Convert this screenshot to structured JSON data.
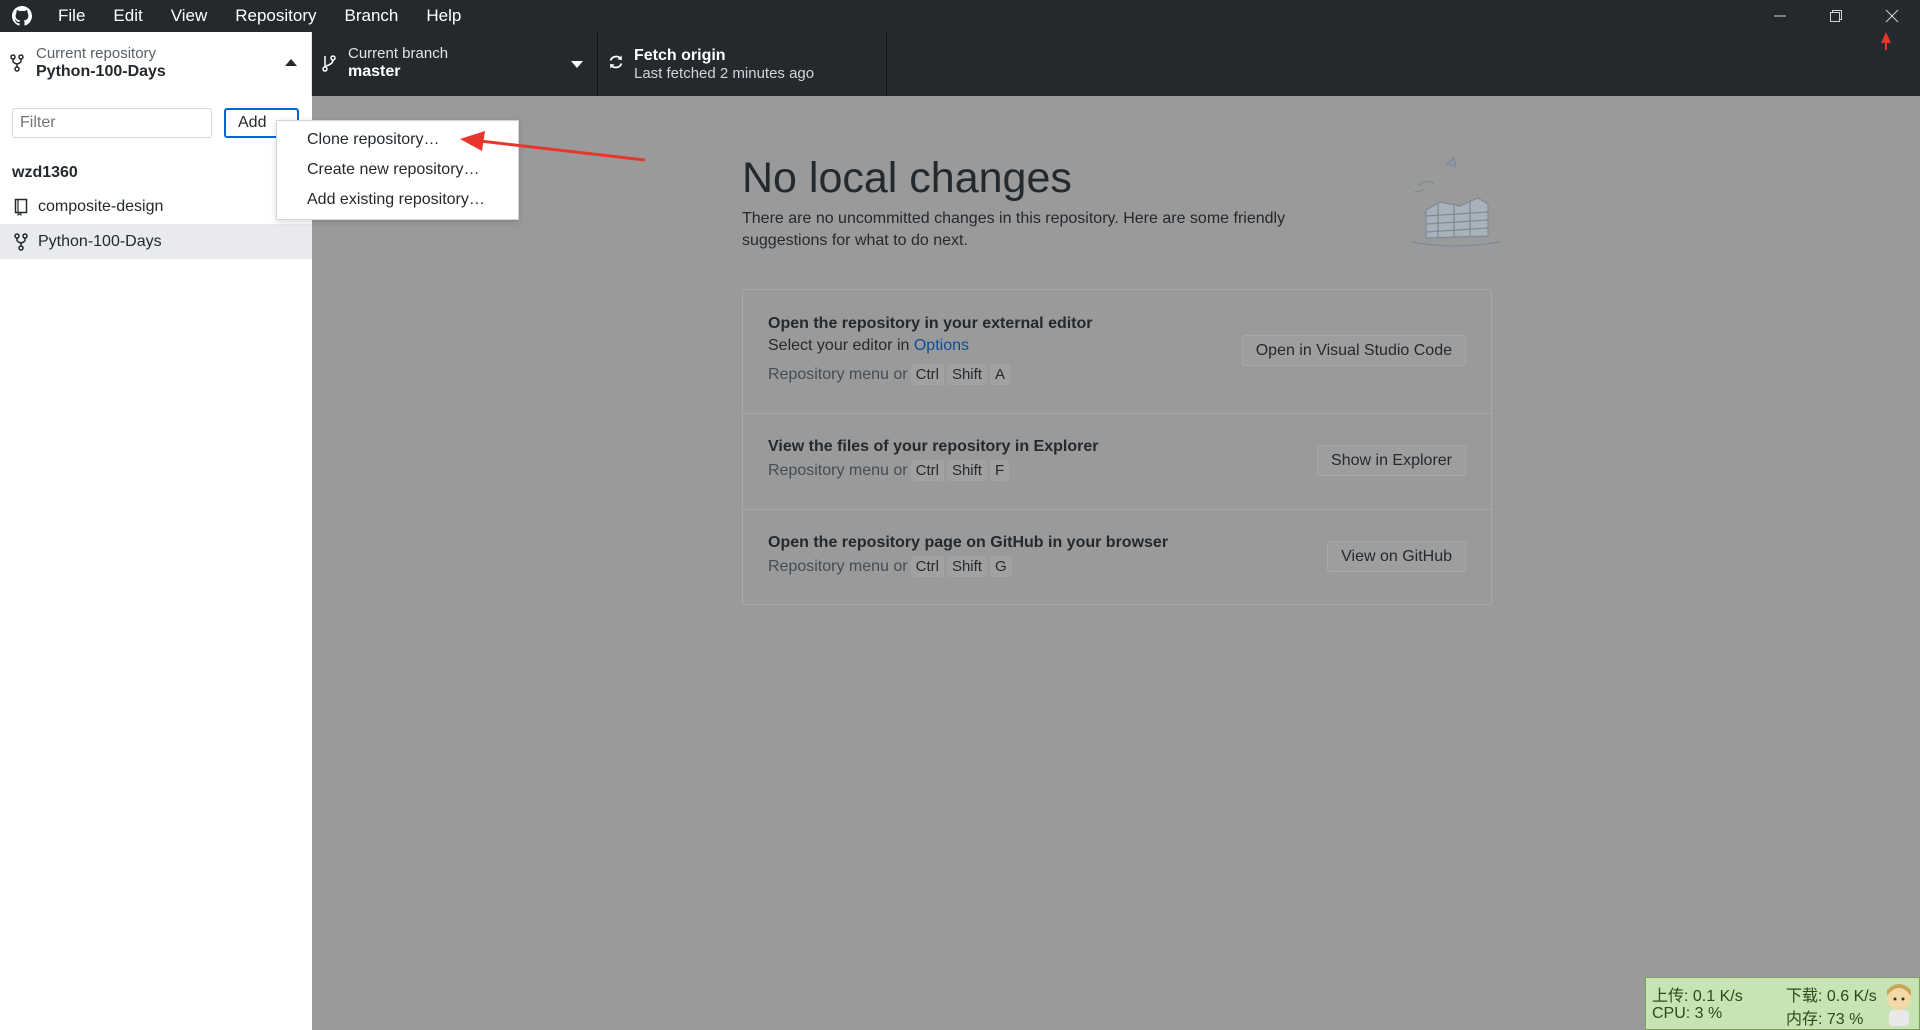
{
  "menubar": {
    "items": [
      "File",
      "Edit",
      "View",
      "Repository",
      "Branch",
      "Help"
    ]
  },
  "toolbar": {
    "repo_label": "Current repository",
    "repo_value": "Python-100-Days",
    "branch_label": "Current branch",
    "branch_value": "master",
    "fetch_label": "Fetch origin",
    "fetch_value": "Last fetched 2 minutes ago"
  },
  "sidebar": {
    "filter_placeholder": "Filter",
    "add_label": "Add",
    "group_title": "wzd1360",
    "repos": [
      {
        "name": "composite-design",
        "icon": "repo-icon",
        "selected": false
      },
      {
        "name": "Python-100-Days",
        "icon": "fork-icon",
        "selected": true
      }
    ]
  },
  "dropdown": {
    "items": [
      "Clone repository…",
      "Create new repository…",
      "Add existing repository…"
    ]
  },
  "main": {
    "heading": "No local changes",
    "description": "There are no uncommitted changes in this repository. Here are some friendly suggestions for what to do next.",
    "suggestions": [
      {
        "title": "Open the repository in your external editor",
        "sub_prefix": "Select your editor in ",
        "sub_link": "Options",
        "shortcut_prefix": "Repository menu or",
        "keys": [
          "Ctrl",
          "Shift",
          "A"
        ],
        "button": "Open in Visual Studio Code"
      },
      {
        "title": "View the files of your repository in Explorer",
        "shortcut_prefix": "Repository menu or",
        "keys": [
          "Ctrl",
          "Shift",
          "F"
        ],
        "button": "Show in Explorer"
      },
      {
        "title": "Open the repository page on GitHub in your browser",
        "shortcut_prefix": "Repository menu or",
        "keys": [
          "Ctrl",
          "Shift",
          "G"
        ],
        "button": "View on GitHub"
      }
    ]
  },
  "netwidget": {
    "upload": "上传: 0.1 K/s",
    "download": "下载: 0.6 K/s",
    "cpu": "CPU: 3 %",
    "memory": "内存: 73 %"
  },
  "colors": {
    "titlebar": "#24292e",
    "accent": "#0366d6",
    "annotation": "#e8362e"
  }
}
